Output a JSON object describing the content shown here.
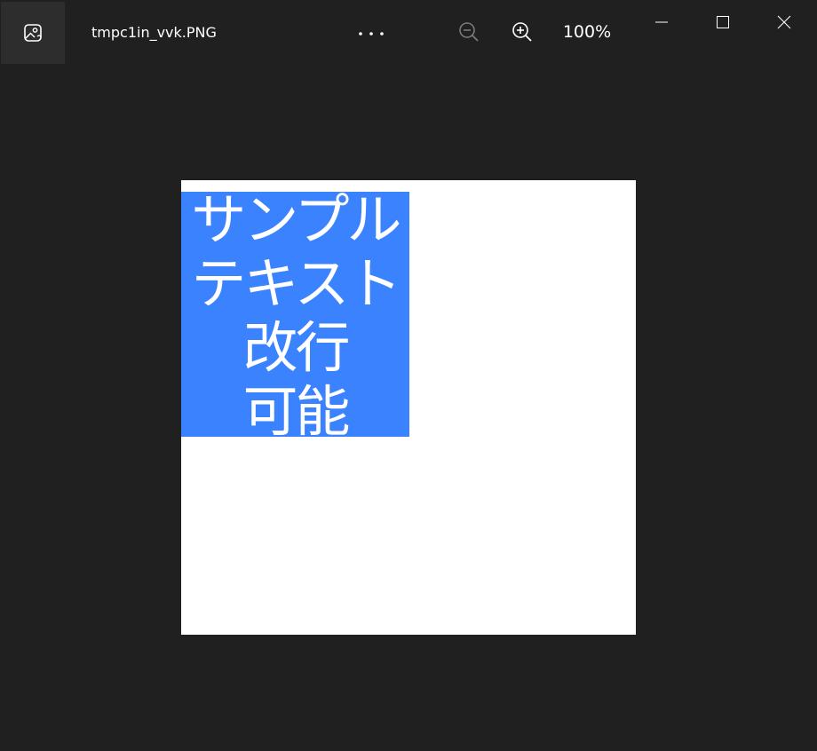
{
  "titlebar": {
    "file_name": "tmpc1in_vvk.PNG",
    "app_icon": "photos-app-icon",
    "more_icon": "more-horizontal-icon",
    "zoom_out_icon": "zoom-out-icon",
    "zoom_in_icon": "zoom-in-icon",
    "zoom_level": "100%",
    "minimize_icon": "minimize-icon",
    "maximize_icon": "maximize-icon",
    "close_icon": "close-icon"
  },
  "image": {
    "text_lines": [
      "サンプル",
      "テキスト",
      "改行",
      "可能"
    ],
    "text_box_color": "#3b82ff",
    "background_color": "#ffffff"
  },
  "theme": {
    "window_background": "#202020",
    "text_color": "#ffffff",
    "disabled_icon_color": "#7a7a7a"
  }
}
